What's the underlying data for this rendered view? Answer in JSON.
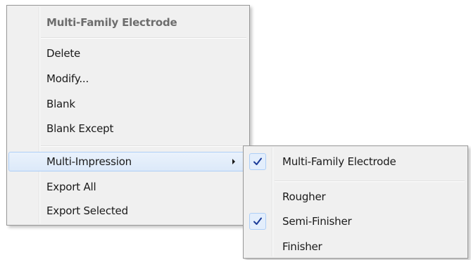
{
  "context_menu": {
    "header": "Multi-Family Electrode",
    "items": [
      {
        "label": "Delete"
      },
      {
        "label": "Modify..."
      },
      {
        "label": "Blank"
      },
      {
        "label": "Blank Except"
      },
      {
        "label": "Multi-Impression",
        "has_submenu": true,
        "highlighted": true
      },
      {
        "label": "Export All"
      },
      {
        "label": "Export Selected"
      }
    ]
  },
  "submenu": {
    "items": [
      {
        "label": "Multi-Family Electrode",
        "checked": true
      },
      {
        "label": "Rougher",
        "checked": false
      },
      {
        "label": "Semi-Finisher",
        "checked": true
      },
      {
        "label": "Finisher",
        "checked": false
      }
    ]
  },
  "icons": {
    "submenu_arrow": "chevron-right-icon",
    "check": "checkmark-icon"
  },
  "colors": {
    "menu_background": "#f0f0f0",
    "menu_border": "#979797",
    "highlight_border": "#aecff7",
    "checkmark": "#1c3c99"
  }
}
